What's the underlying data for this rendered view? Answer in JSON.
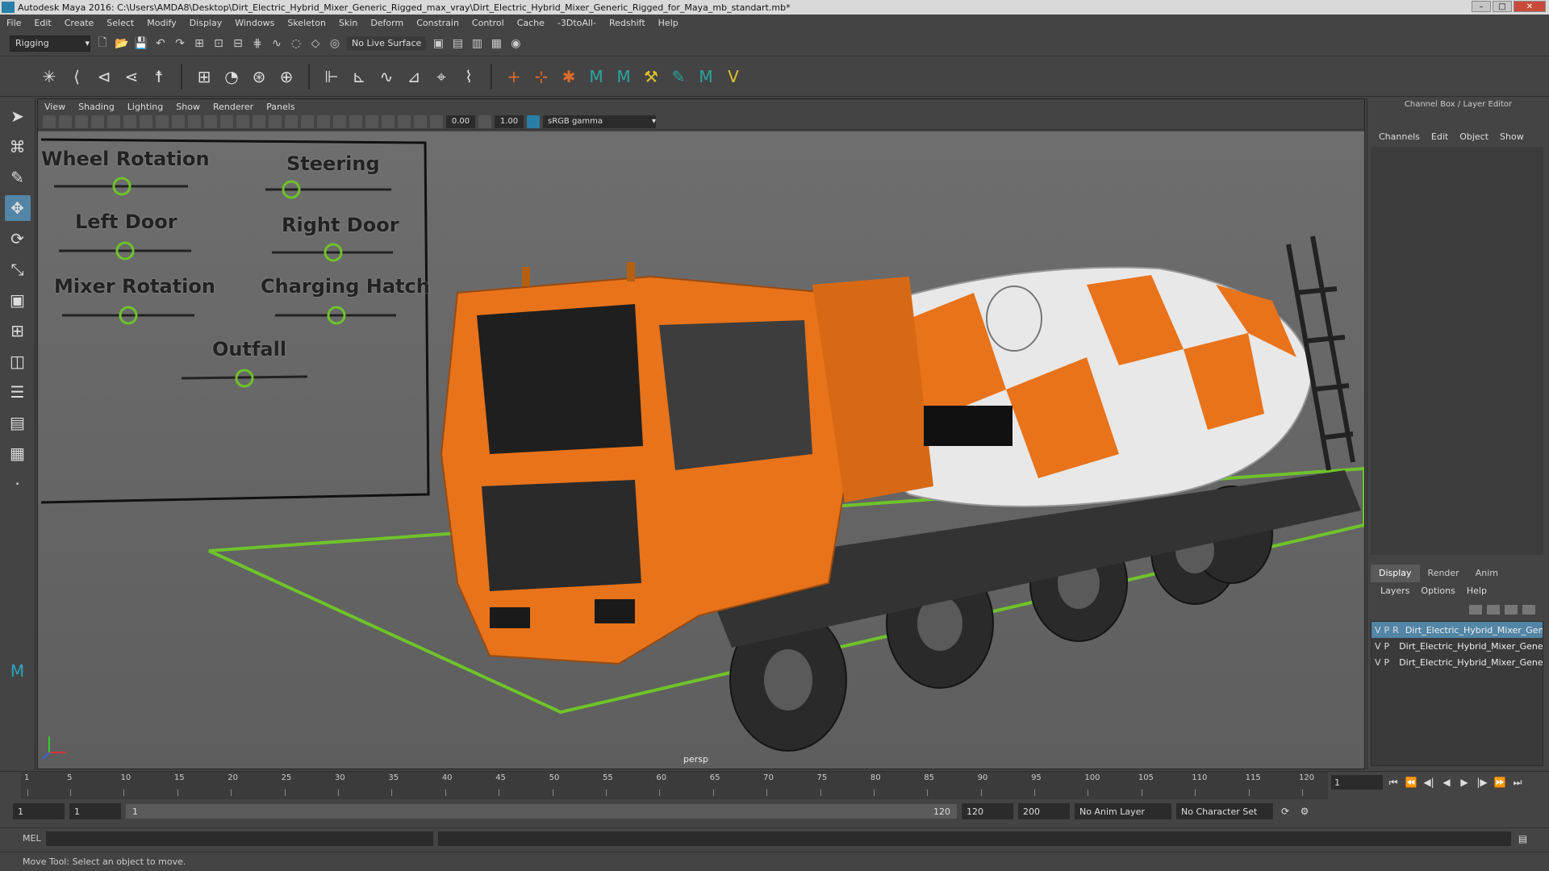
{
  "window": {
    "title": "Autodesk Maya 2016: C:\\Users\\AMDA8\\Desktop\\Dirt_Electric_Hybrid_Mixer_Generic_Rigged_max_vray\\Dirt_Electric_Hybrid_Mixer_Generic_Rigged_for_Maya_mb_standart.mb*"
  },
  "menubar": [
    "File",
    "Edit",
    "Create",
    "Select",
    "Modify",
    "Display",
    "Windows",
    "Skeleton",
    "Skin",
    "Deform",
    "Constrain",
    "Control",
    "Cache",
    "-3DtoAll-",
    "Redshift",
    "Help"
  ],
  "statusline": {
    "mode": "Rigging",
    "live_surface": "No Live Surface"
  },
  "viewport": {
    "menu": [
      "View",
      "Shading",
      "Lighting",
      "Show",
      "Renderer",
      "Panels"
    ],
    "exposure": "0.00",
    "gamma": "1.00",
    "color_space": "sRGB gamma",
    "camera_label": "persp"
  },
  "controls": {
    "wheel_rotation": "Wheel Rotation",
    "steering": "Steering",
    "left_door": "Left Door",
    "right_door": "Right Door",
    "mixer_rotation": "Mixer Rotation",
    "charging_hatch": "Charging Hatch",
    "outfall": "Outfall"
  },
  "channel_box": {
    "title": "Channel Box / Layer Editor",
    "menu": [
      "Channels",
      "Edit",
      "Object",
      "Show"
    ]
  },
  "layer_editor": {
    "tabs": [
      "Display",
      "Render",
      "Anim"
    ],
    "active_tab": "Display",
    "menu": [
      "Layers",
      "Options",
      "Help"
    ],
    "layers": [
      {
        "v": "V",
        "p": "P",
        "r": "R",
        "color": "#1f6e3a",
        "name": "Dirt_Electric_Hybrid_Mixer_Generic_Rigged_controllers",
        "selected": true
      },
      {
        "v": "V",
        "p": "P",
        "r": "",
        "color": "#1a1a8a",
        "name": "Dirt_Electric_Hybrid_Mixer_Generic_Rigged_helpers",
        "selected": false
      },
      {
        "v": "V",
        "p": "P",
        "r": "",
        "color": "#4caf30",
        "name": "Dirt_Electric_Hybrid_Mixer_Generic_Rigged_geometry",
        "selected": false
      }
    ]
  },
  "timeline": {
    "ticks": [
      "1",
      "5",
      "10",
      "15",
      "20",
      "25",
      "30",
      "35",
      "40",
      "45",
      "50",
      "55",
      "60",
      "65",
      "70",
      "75",
      "80",
      "85",
      "90",
      "95",
      "100",
      "105",
      "110",
      "115",
      "120"
    ],
    "current_frame": "1"
  },
  "range": {
    "start": "1",
    "playback_start": "1",
    "slider_start": "1",
    "slider_end": "120",
    "playback_end": "120",
    "end": "200",
    "anim_layer": "No Anim Layer",
    "character_set": "No Character Set"
  },
  "cmdline": {
    "label": "MEL"
  },
  "helpline": {
    "text": "Move Tool: Select an object to move."
  }
}
